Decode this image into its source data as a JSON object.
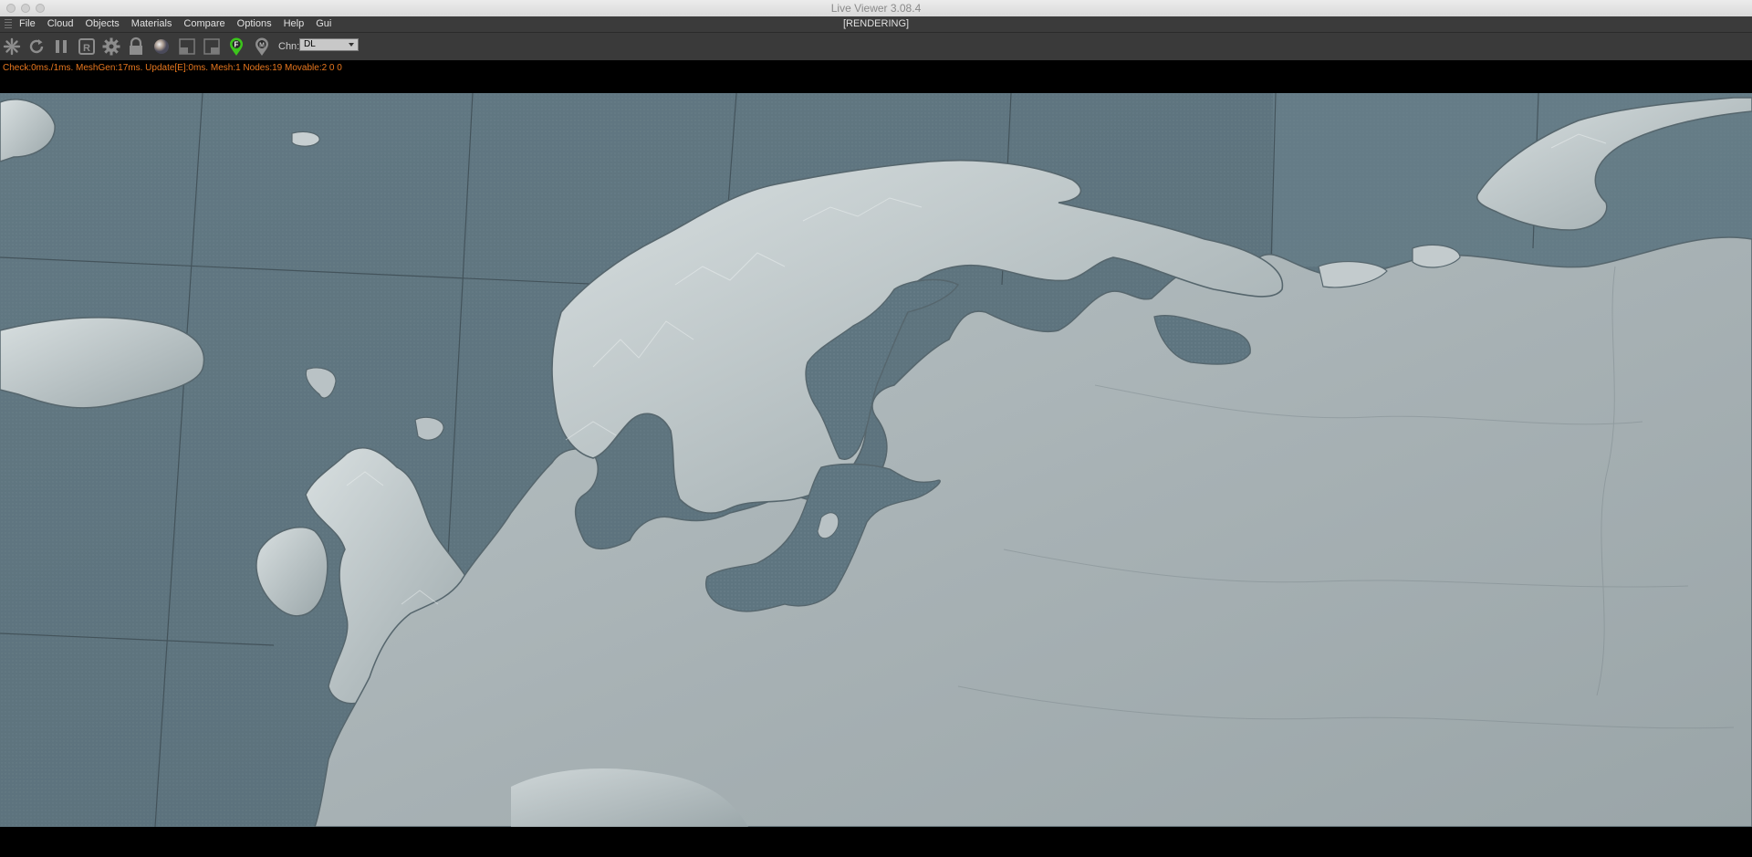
{
  "window": {
    "title": "Live Viewer 3.08.4"
  },
  "menu": {
    "items": [
      "File",
      "Cloud",
      "Objects",
      "Materials",
      "Compare",
      "Options",
      "Help",
      "Gui"
    ]
  },
  "render_status": "[RENDERING]",
  "toolbar": {
    "buttons": [
      "snake-icon",
      "refresh-icon",
      "pause-icon",
      "region-render-icon",
      "settings-gear-icon",
      "lock-icon",
      "material-ball-icon",
      "window-icon",
      "window-alt-icon",
      "pin-f-icon",
      "pin-m-icon"
    ],
    "pin_f_label": "F",
    "pin_m_label": "M",
    "region_label": "R",
    "channel_label": "Chn:",
    "channel_value": "DL"
  },
  "status_line": "Check:0ms./1ms. MeshGen:17ms. Update[E]:0ms. Mesh:1 Nodes:19 Movable:2  0 0",
  "colors": {
    "sea": "#5e7580",
    "land": "#a9b3b6",
    "status_text": "#e8771e",
    "pin_green": "#3cc51c"
  }
}
